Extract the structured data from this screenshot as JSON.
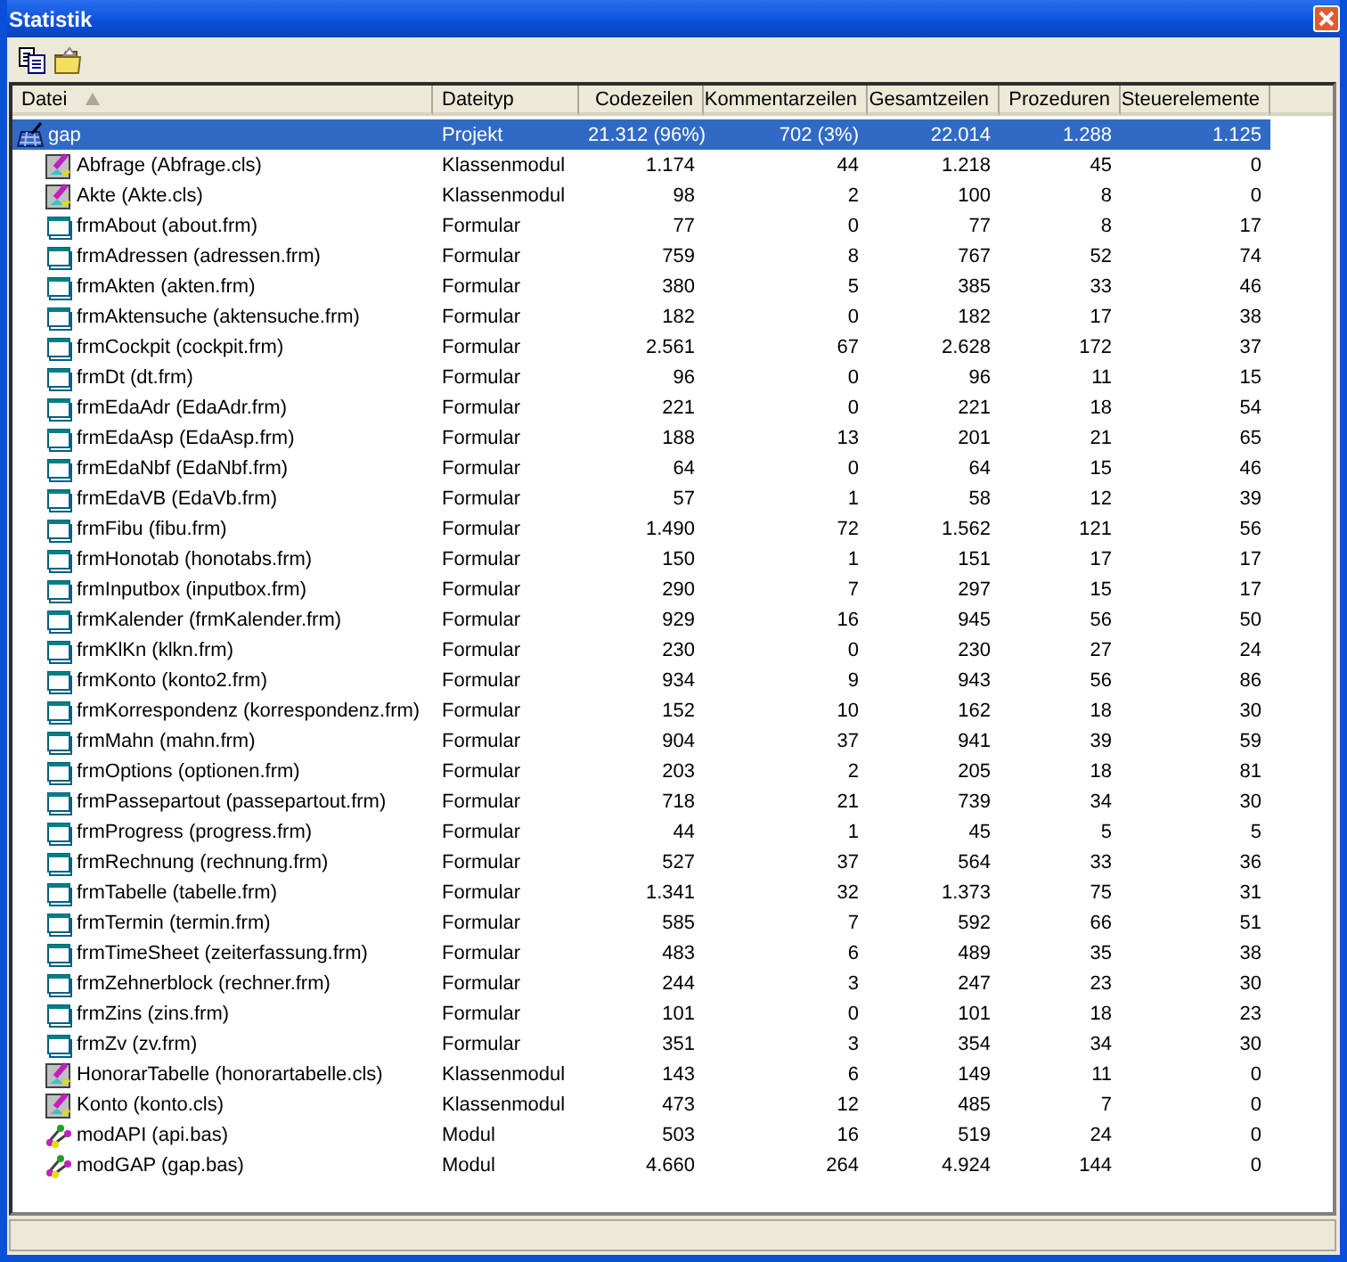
{
  "window": {
    "title": "Statistik"
  },
  "table": {
    "columns": [
      {
        "label": "Datei",
        "sorted": true
      },
      {
        "label": "Dateityp",
        "sorted": false
      },
      {
        "label": "Codezeilen",
        "sorted": false
      },
      {
        "label": "Kommentarzeilen",
        "sorted": false
      },
      {
        "label": "Gesamtzeilen",
        "sorted": false
      },
      {
        "label": "Prozeduren",
        "sorted": false
      },
      {
        "label": "Steuerelemente",
        "sorted": false
      }
    ],
    "rows": [
      {
        "kind": "project",
        "cells": [
          "gap",
          "Projekt",
          "21.312 (96%)",
          "702 (3%)",
          "22.014",
          "1.288",
          "1.125"
        ],
        "selected": true,
        "children": [
          {
            "kind": "class",
            "cells": [
              "Abfrage (Abfrage.cls)",
              "Klassenmodul",
              "1.174",
              "44",
              "1.218",
              "45",
              "0"
            ],
            "selected": false
          },
          {
            "kind": "class",
            "cells": [
              "Akte (Akte.cls)",
              "Klassenmodul",
              "98",
              "2",
              "100",
              "8",
              "0"
            ],
            "selected": false
          },
          {
            "kind": "form",
            "cells": [
              "frmAbout (about.frm)",
              "Formular",
              "77",
              "0",
              "77",
              "8",
              "17"
            ],
            "selected": false
          },
          {
            "kind": "form",
            "cells": [
              "frmAdressen (adressen.frm)",
              "Formular",
              "759",
              "8",
              "767",
              "52",
              "74"
            ],
            "selected": false
          },
          {
            "kind": "form",
            "cells": [
              "frmAkten (akten.frm)",
              "Formular",
              "380",
              "5",
              "385",
              "33",
              "46"
            ],
            "selected": false
          },
          {
            "kind": "form",
            "cells": [
              "frmAktensuche (aktensuche.frm)",
              "Formular",
              "182",
              "0",
              "182",
              "17",
              "38"
            ],
            "selected": false
          },
          {
            "kind": "form",
            "cells": [
              "frmCockpit (cockpit.frm)",
              "Formular",
              "2.561",
              "67",
              "2.628",
              "172",
              "37"
            ],
            "selected": false
          },
          {
            "kind": "form",
            "cells": [
              "frmDt (dt.frm)",
              "Formular",
              "96",
              "0",
              "96",
              "11",
              "15"
            ],
            "selected": false
          },
          {
            "kind": "form",
            "cells": [
              "frmEdaAdr (EdaAdr.frm)",
              "Formular",
              "221",
              "0",
              "221",
              "18",
              "54"
            ],
            "selected": false
          },
          {
            "kind": "form",
            "cells": [
              "frmEdaAsp (EdaAsp.frm)",
              "Formular",
              "188",
              "13",
              "201",
              "21",
              "65"
            ],
            "selected": false
          },
          {
            "kind": "form",
            "cells": [
              "frmEdaNbf (EdaNbf.frm)",
              "Formular",
              "64",
              "0",
              "64",
              "15",
              "46"
            ],
            "selected": false
          },
          {
            "kind": "form",
            "cells": [
              "frmEdaVB (EdaVb.frm)",
              "Formular",
              "57",
              "1",
              "58",
              "12",
              "39"
            ],
            "selected": false
          },
          {
            "kind": "form",
            "cells": [
              "frmFibu (fibu.frm)",
              "Formular",
              "1.490",
              "72",
              "1.562",
              "121",
              "56"
            ],
            "selected": false
          },
          {
            "kind": "form",
            "cells": [
              "frmHonotab (honotabs.frm)",
              "Formular",
              "150",
              "1",
              "151",
              "17",
              "17"
            ],
            "selected": false
          },
          {
            "kind": "form",
            "cells": [
              "frmInputbox (inputbox.frm)",
              "Formular",
              "290",
              "7",
              "297",
              "15",
              "17"
            ],
            "selected": false
          },
          {
            "kind": "form",
            "cells": [
              "frmKalender (frmKalender.frm)",
              "Formular",
              "929",
              "16",
              "945",
              "56",
              "50"
            ],
            "selected": false
          },
          {
            "kind": "form",
            "cells": [
              "frmKlKn (klkn.frm)",
              "Formular",
              "230",
              "0",
              "230",
              "27",
              "24"
            ],
            "selected": false
          },
          {
            "kind": "form",
            "cells": [
              "frmKonto (konto2.frm)",
              "Formular",
              "934",
              "9",
              "943",
              "56",
              "86"
            ],
            "selected": false
          },
          {
            "kind": "form",
            "cells": [
              "frmKorrespondenz (korrespondenz.frm)",
              "Formular",
              "152",
              "10",
              "162",
              "18",
              "30"
            ],
            "selected": false
          },
          {
            "kind": "form",
            "cells": [
              "frmMahn (mahn.frm)",
              "Formular",
              "904",
              "37",
              "941",
              "39",
              "59"
            ],
            "selected": false
          },
          {
            "kind": "form",
            "cells": [
              "frmOptions (optionen.frm)",
              "Formular",
              "203",
              "2",
              "205",
              "18",
              "81"
            ],
            "selected": false
          },
          {
            "kind": "form",
            "cells": [
              "frmPassepartout (passepartout.frm)",
              "Formular",
              "718",
              "21",
              "739",
              "34",
              "30"
            ],
            "selected": false
          },
          {
            "kind": "form",
            "cells": [
              "frmProgress (progress.frm)",
              "Formular",
              "44",
              "1",
              "45",
              "5",
              "5"
            ],
            "selected": false
          },
          {
            "kind": "form",
            "cells": [
              "frmRechnung (rechnung.frm)",
              "Formular",
              "527",
              "37",
              "564",
              "33",
              "36"
            ],
            "selected": false
          },
          {
            "kind": "form",
            "cells": [
              "frmTabelle (tabelle.frm)",
              "Formular",
              "1.341",
              "32",
              "1.373",
              "75",
              "31"
            ],
            "selected": false
          },
          {
            "kind": "form",
            "cells": [
              "frmTermin (termin.frm)",
              "Formular",
              "585",
              "7",
              "592",
              "66",
              "51"
            ],
            "selected": false
          },
          {
            "kind": "form",
            "cells": [
              "frmTimeSheet (zeiterfassung.frm)",
              "Formular",
              "483",
              "6",
              "489",
              "35",
              "38"
            ],
            "selected": false
          },
          {
            "kind": "form",
            "cells": [
              "frmZehnerblock (rechner.frm)",
              "Formular",
              "244",
              "3",
              "247",
              "23",
              "30"
            ],
            "selected": false
          },
          {
            "kind": "form",
            "cells": [
              "frmZins (zins.frm)",
              "Formular",
              "101",
              "0",
              "101",
              "18",
              "23"
            ],
            "selected": false
          },
          {
            "kind": "form",
            "cells": [
              "frmZv (zv.frm)",
              "Formular",
              "351",
              "3",
              "354",
              "34",
              "30"
            ],
            "selected": false
          },
          {
            "kind": "class",
            "cells": [
              "HonorarTabelle (honorartabelle.cls)",
              "Klassenmodul",
              "143",
              "6",
              "149",
              "11",
              "0"
            ],
            "selected": false
          },
          {
            "kind": "class",
            "cells": [
              "Konto (konto.cls)",
              "Klassenmodul",
              "473",
              "12",
              "485",
              "7",
              "0"
            ],
            "selected": false
          },
          {
            "kind": "module",
            "cells": [
              "modAPI (api.bas)",
              "Modul",
              "503",
              "16",
              "519",
              "24",
              "0"
            ],
            "selected": false
          },
          {
            "kind": "module",
            "cells": [
              "modGAP (gap.bas)",
              "Modul",
              "4.660",
              "264",
              "4.924",
              "144",
              "0"
            ],
            "selected": false
          }
        ]
      }
    ]
  }
}
